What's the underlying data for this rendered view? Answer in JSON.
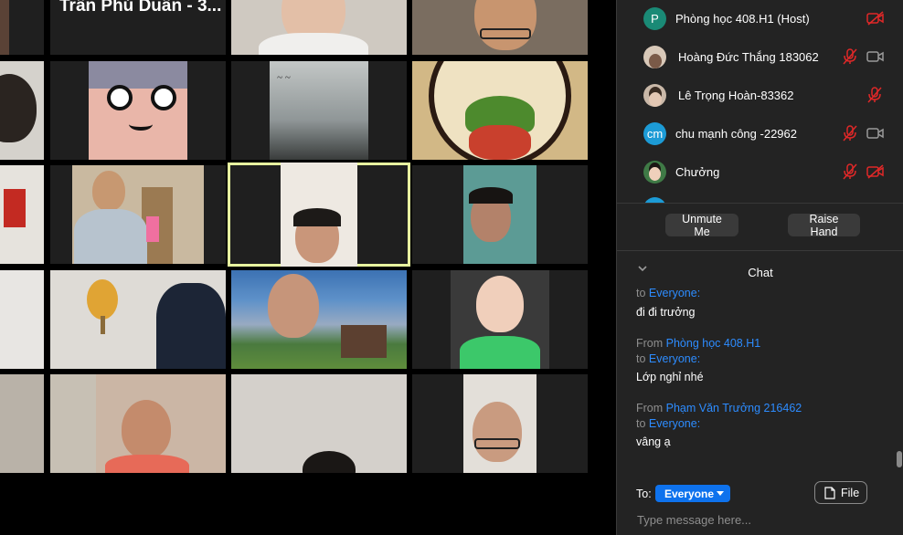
{
  "grid": {
    "active_speaker_label": "Trần Phú Duân - 3..."
  },
  "participants": [
    {
      "name": "Phòng học 408.H1 (Host)",
      "avatar_letter": "P",
      "avatar_color": "#1a8a76",
      "mic": "none",
      "video": "off"
    },
    {
      "name": "Hoàng Đức Thắng 183062",
      "avatar_letter": "",
      "avatar_color": "#d8c8b8",
      "mic": "muted",
      "video": "on"
    },
    {
      "name": "Lê Trọng Hoàn-83362",
      "avatar_letter": "",
      "avatar_color": "#c9b8a8",
      "mic": "muted",
      "video": "none"
    },
    {
      "name": "chu mạnh công -22962",
      "avatar_letter": "cm",
      "avatar_color": "#1c9bd6",
      "mic": "muted",
      "video": "on"
    },
    {
      "name": "Chưởng",
      "avatar_letter": "",
      "avatar_color": "#3f7a46",
      "mic": "muted",
      "video": "off"
    }
  ],
  "controls": {
    "unmute_label": "Unmute Me",
    "raise_hand_label": "Raise Hand"
  },
  "chat": {
    "title": "Chat",
    "messages": [
      {
        "from_prefix": "",
        "from": "",
        "to_prefix": "to ",
        "to": "Everyone:",
        "text": "đi đi trưởng"
      },
      {
        "from_prefix": "From ",
        "from": "Phòng học 408.H1",
        "to_prefix": "to ",
        "to": "Everyone:",
        "text": "Lớp nghỉ nhé"
      },
      {
        "from_prefix": "From ",
        "from": "Phạm Văn Trưởng 216462",
        "to_prefix": "to ",
        "to": "Everyone:",
        "text": "vâng ạ"
      }
    ],
    "to_label": "To:",
    "recipient": "Everyone",
    "file_label": "File",
    "input_placeholder": "Type message here..."
  },
  "colors": {
    "accent_blue": "#2d8cff",
    "muted_red": "#e02828",
    "active_speaker_outline": "#e8f5a0"
  }
}
